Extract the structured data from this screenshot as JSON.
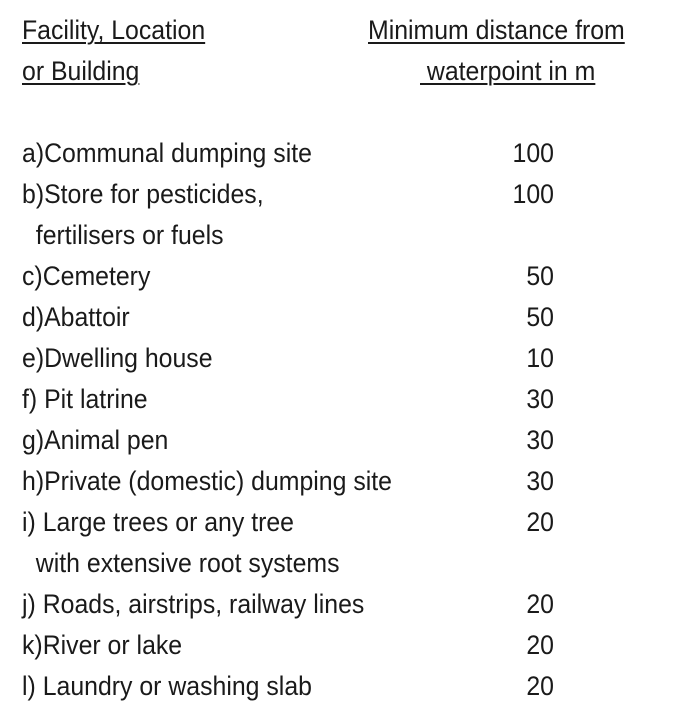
{
  "header": {
    "left": [
      "Facility, Location",
      "or Building"
    ],
    "right": [
      "Minimum distance from",
      " waterpoint in m"
    ]
  },
  "rows": [
    {
      "label": "a)Communal dumping site",
      "value": "100"
    },
    {
      "label": "b)Store for pesticides,",
      "value": "100"
    },
    {
      "label": "  fertilisers or fuels",
      "value": ""
    },
    {
      "label": "c)Cemetery",
      "value": "50"
    },
    {
      "label": "d)Abattoir",
      "value": "50"
    },
    {
      "label": "e)Dwelling house",
      "value": "10"
    },
    {
      "label": "f) Pit latrine",
      "value": "30"
    },
    {
      "label": "g)Animal pen",
      "value": "30"
    },
    {
      "label": "h)Private (domestic) dumping site",
      "value": "30"
    },
    {
      "label": "i) Large trees or any tree",
      "value": "20"
    },
    {
      "label": "  with extensive root systems",
      "value": ""
    },
    {
      "label": "j) Roads, airstrips, railway lines",
      "value": "20"
    },
    {
      "label": "k)River or lake",
      "value": "20"
    },
    {
      "label": "l) Laundry or washing slab",
      "value": "20"
    }
  ]
}
